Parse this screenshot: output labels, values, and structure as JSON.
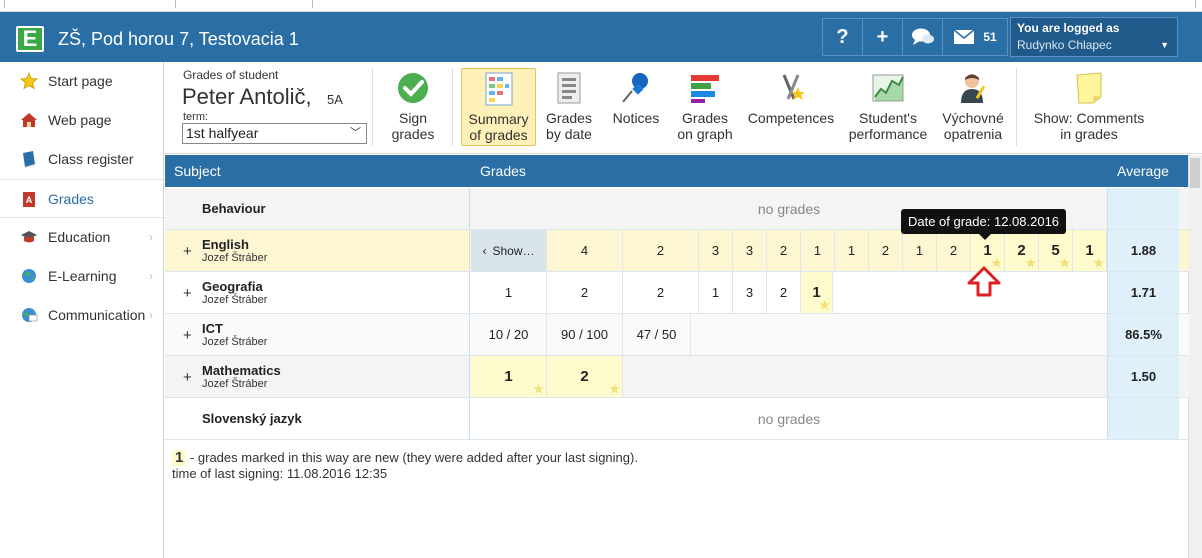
{
  "header": {
    "logo_letter": "E",
    "title": "ZŠ, Pod horou 7, Testovacia 1",
    "help": "?",
    "add": "+",
    "mail_count": "51",
    "logged_label": "You are logged as",
    "logged_user": "Rudynko Chlapec"
  },
  "sidebar": {
    "items": [
      {
        "label": "Start page",
        "icon": "star-icon"
      },
      {
        "label": "Web page",
        "icon": "home-icon"
      },
      {
        "label": "Class register",
        "icon": "book-icon"
      },
      {
        "label": "Grades",
        "icon": "grades-icon",
        "active": true
      },
      {
        "label": "Education",
        "icon": "education-icon",
        "expandable": true
      },
      {
        "label": "E-Learning",
        "icon": "globe-icon",
        "expandable": true
      },
      {
        "label": "Communication",
        "icon": "communication-icon",
        "expandable": true
      }
    ]
  },
  "student": {
    "label": "Grades of student",
    "name": "Peter Antolič,",
    "class": "5A",
    "term_label": "term:",
    "term_value": "1st halfyear"
  },
  "toolbar": {
    "sign": [
      "Sign",
      "grades"
    ],
    "summary": [
      "Summary",
      "of grades"
    ],
    "bydate": [
      "Grades",
      "by date"
    ],
    "notices": [
      "Notices",
      ""
    ],
    "graph": [
      "Grades",
      "on graph"
    ],
    "competences": [
      "Competences",
      ""
    ],
    "performance": [
      "Student's",
      "performance"
    ],
    "measures": [
      "Výchovné",
      "opatrenia"
    ],
    "comments": [
      "Show: Comments",
      "in grades"
    ]
  },
  "table": {
    "col_subject": "Subject",
    "col_grades": "Grades",
    "col_average": "Average",
    "no_grades": "no grades",
    "show_label": "Show…",
    "rows": [
      {
        "subject": "Behaviour",
        "teacher": "",
        "grades": [],
        "average": ""
      },
      {
        "subject": "English",
        "teacher": "Jozef Štráber",
        "grades": [
          "4",
          "2",
          "3",
          "3",
          "2",
          "1",
          "1",
          "2",
          "1",
          "2",
          "1",
          "2",
          "5",
          "1"
        ],
        "average": "1.88"
      },
      {
        "subject": "Geografia",
        "teacher": "Jozef Štráber",
        "grades": [
          "1",
          "2",
          "2",
          "1",
          "3",
          "2",
          "1"
        ],
        "average": "1.71"
      },
      {
        "subject": "ICT",
        "teacher": "Jozef Štráber",
        "grades": [
          "10 / 20",
          "90 / 100",
          "47 / 50"
        ],
        "average": "86.5%"
      },
      {
        "subject": "Mathematics",
        "teacher": "Jozef Štráber",
        "grades": [
          "1",
          "2"
        ],
        "average": "1.50"
      },
      {
        "subject": "Slovenský jazyk",
        "teacher": "",
        "grades": [],
        "average": ""
      }
    ]
  },
  "tooltip": "Date of grade: 12.08.2016",
  "legend": {
    "sample": "1",
    "text": " - grades marked in this way are new (they were added after your last signing).",
    "last_signing": "time of last signing: 11.08.2016 12:35"
  }
}
